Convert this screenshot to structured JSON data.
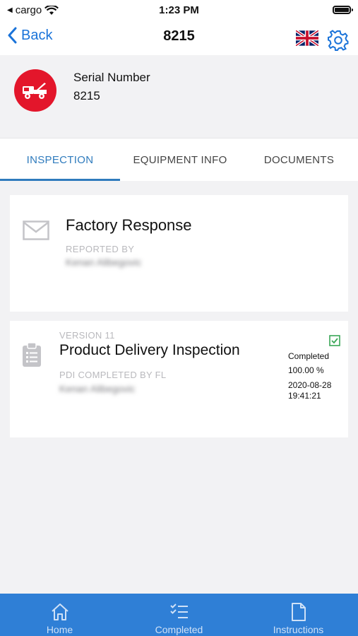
{
  "status_bar": {
    "carrier": "cargo",
    "time": "1:23 PM"
  },
  "nav": {
    "back_label": "Back",
    "title": "8215"
  },
  "header": {
    "serial_label": "Serial Number",
    "serial_value": "8215"
  },
  "tabs": [
    {
      "label": "INSPECTION",
      "active": true
    },
    {
      "label": "EQUIPMENT INFO",
      "active": false
    },
    {
      "label": "DOCUMENTS",
      "active": false
    }
  ],
  "cards": [
    {
      "title": "Factory Response",
      "label": "REPORTED BY",
      "person": "Kenan Alibegovic"
    },
    {
      "version": "VERSION 11",
      "title": "Product Delivery Inspection",
      "label": "PDI COMPLETED BY FL",
      "person": "Kenan Alibegovic",
      "status": "Completed",
      "percent": "100.00 %",
      "date": "2020-08-28",
      "time": "19:41:21"
    }
  ],
  "tabbar": [
    {
      "label": "Home",
      "icon": "home-icon"
    },
    {
      "label": "Completed",
      "icon": "checklist-icon"
    },
    {
      "label": "Instructions",
      "icon": "document-icon"
    }
  ],
  "colors": {
    "accent": "#2f7bbd",
    "tabbar": "#2f7fd6",
    "brand_red": "#e3162b",
    "check_green": "#3aa757"
  }
}
